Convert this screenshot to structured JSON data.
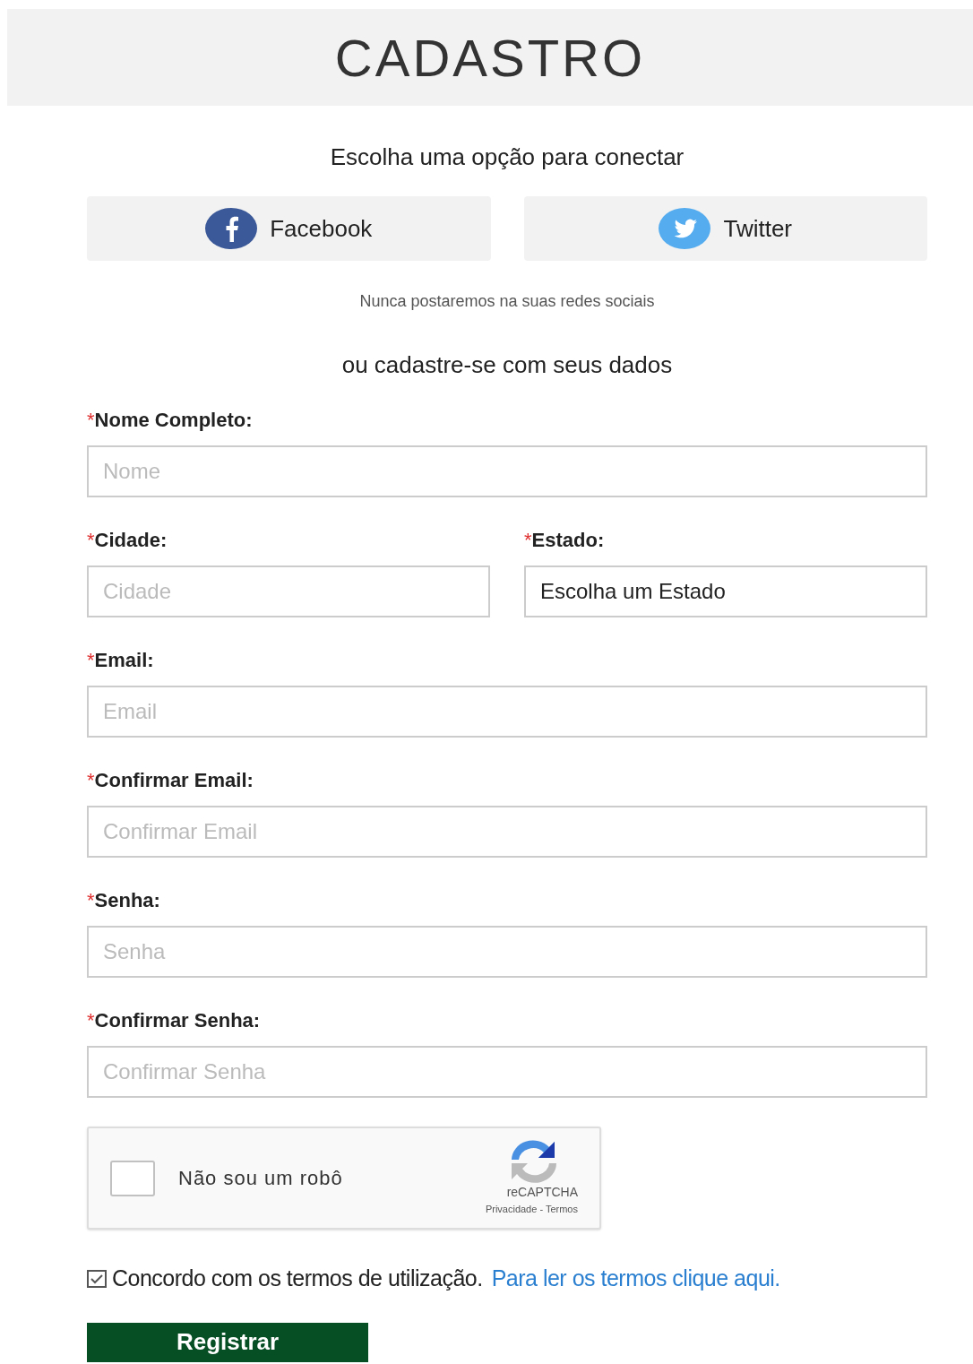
{
  "header": {
    "title": "CADASTRO"
  },
  "social": {
    "prompt": "Escolha uma opção para conectar",
    "buttons": [
      {
        "kind": "facebook",
        "label": "Facebook"
      },
      {
        "kind": "twitter",
        "label": "Twitter"
      }
    ],
    "note": "Nunca postaremos na suas redes sociais"
  },
  "divider_text": "ou cadastre-se com seus dados",
  "form_rows": [
    [
      {
        "kind": "input",
        "required_mark": "*",
        "label": "Nome Completo:",
        "placeholder": "Nome"
      }
    ],
    [
      {
        "kind": "input",
        "required_mark": "*",
        "label": "Cidade:",
        "placeholder": "Cidade"
      },
      {
        "kind": "select",
        "required_mark": "*",
        "label": "Estado:",
        "value": "Escolha um Estado"
      }
    ],
    [
      {
        "kind": "input",
        "required_mark": "*",
        "label": "Email:",
        "placeholder": "Email"
      }
    ],
    [
      {
        "kind": "input",
        "required_mark": "*",
        "label": "Confirmar Email:",
        "placeholder": "Confirmar Email"
      }
    ],
    [
      {
        "kind": "input",
        "required_mark": "*",
        "label": "Senha:",
        "placeholder": "Senha"
      }
    ],
    [
      {
        "kind": "input",
        "required_mark": "*",
        "label": "Confirmar Senha:",
        "placeholder": "Confirmar Senha"
      }
    ]
  ],
  "captcha": {
    "checked": false,
    "label": "Não sou um robô",
    "brand": "reCAPTCHA",
    "links": "Privacidade - Termos"
  },
  "terms": {
    "checked": true,
    "text": "Concordo com os termos de utilização.",
    "link": "Para ler os termos clique aqui."
  },
  "submit": {
    "label": "Registrar"
  }
}
